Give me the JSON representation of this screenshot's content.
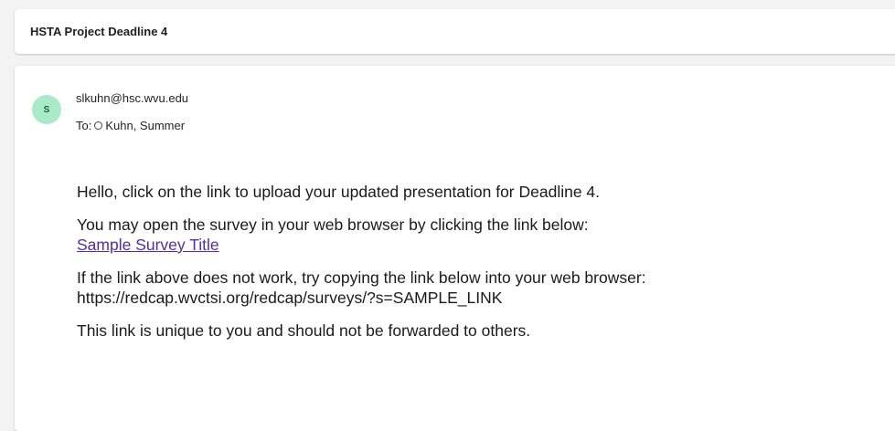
{
  "subject": "HSTA Project Deadline 4",
  "sender": {
    "avatar_initial": "S",
    "email": "slkuhn@hsc.wvu.edu",
    "to_label": "To:",
    "recipient": "Kuhn, Summer"
  },
  "body": {
    "p1": "Hello, click on the link to upload your updated presentation for Deadline 4.",
    "p2_line1": "You may open the survey in your web browser by clicking the link below:",
    "p2_link": "Sample Survey Title",
    "p3_line1": "If the link above does not work, try copying the link below into your web browser:",
    "p3_line2": "https://redcap.wvctsi.org/redcap/surveys/?s=SAMPLE_LINK",
    "p4": "This link is unique to you and should not be forwarded to others."
  },
  "colors": {
    "avatar_bg": "#a9ebc9",
    "link": "#4f2fa3"
  }
}
